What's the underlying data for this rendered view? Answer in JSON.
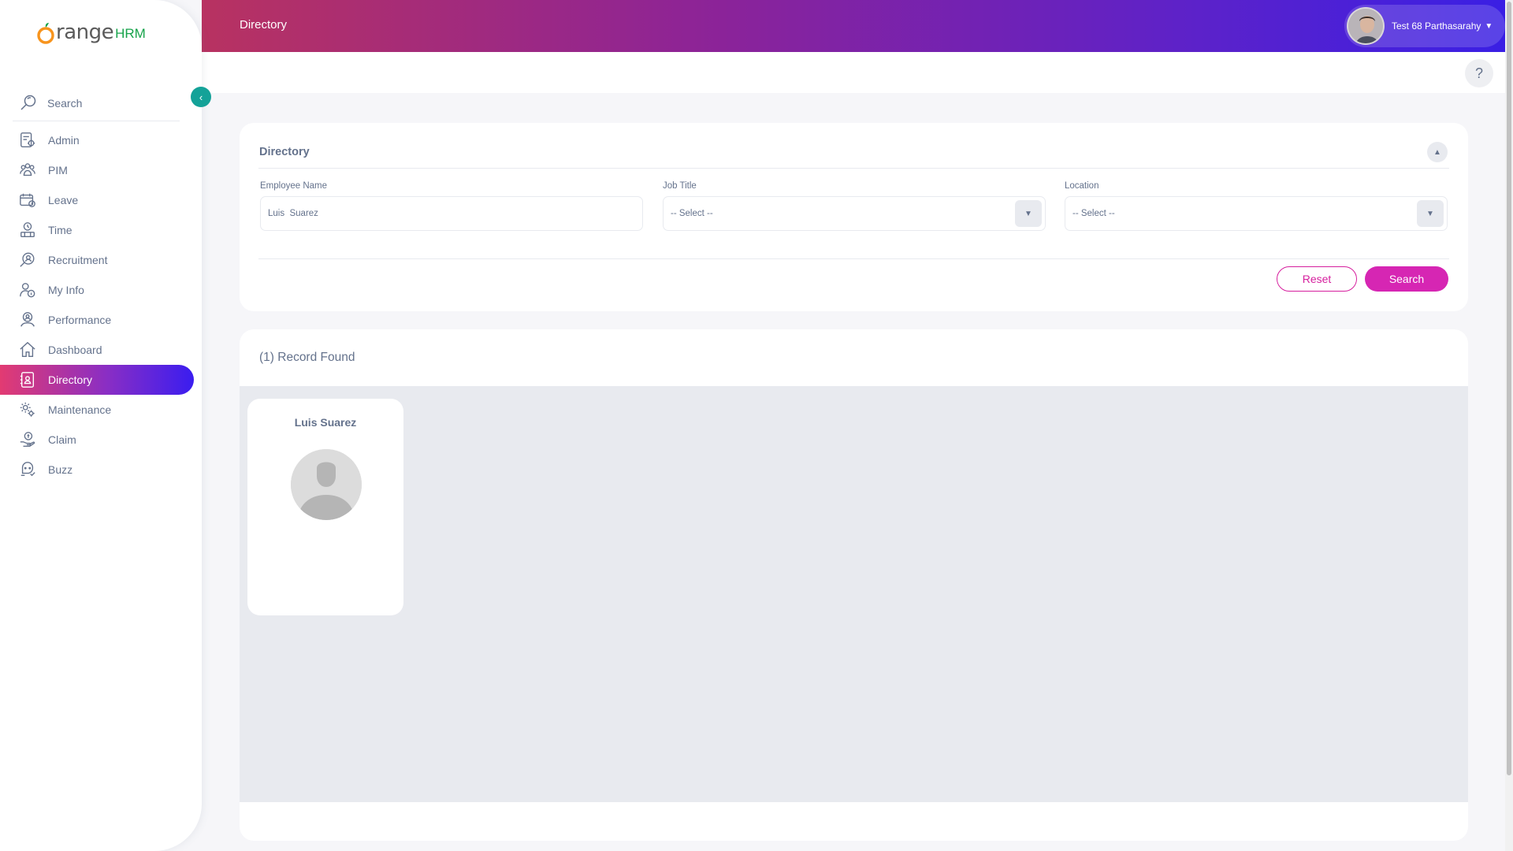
{
  "app": {
    "brand_text": "range",
    "brand_suffix": "HRM"
  },
  "topbar": {
    "title": "Directory",
    "user_name": "Test 68 Parthasarahy"
  },
  "sidebar": {
    "search_placeholder": "Search",
    "items": [
      {
        "label": "Admin",
        "icon": "admin-icon"
      },
      {
        "label": "PIM",
        "icon": "pim-icon"
      },
      {
        "label": "Leave",
        "icon": "leave-icon"
      },
      {
        "label": "Time",
        "icon": "time-icon"
      },
      {
        "label": "Recruitment",
        "icon": "recruitment-icon"
      },
      {
        "label": "My Info",
        "icon": "my-info-icon"
      },
      {
        "label": "Performance",
        "icon": "performance-icon"
      },
      {
        "label": "Dashboard",
        "icon": "dashboard-icon"
      },
      {
        "label": "Directory",
        "icon": "directory-icon",
        "active": true
      },
      {
        "label": "Maintenance",
        "icon": "maintenance-icon"
      },
      {
        "label": "Claim",
        "icon": "claim-icon"
      },
      {
        "label": "Buzz",
        "icon": "buzz-icon"
      }
    ]
  },
  "help": {
    "label": "?"
  },
  "filter": {
    "title": "Directory",
    "employee_name_label": "Employee Name",
    "employee_name_value": "Luis  Suarez",
    "job_title_label": "Job Title",
    "job_title_value": "-- Select --",
    "location_label": "Location",
    "location_value": "-- Select --",
    "reset_label": "Reset",
    "search_label": "Search"
  },
  "results": {
    "record_count": "(1) Record Found",
    "employees": [
      {
        "name": "Luis Suarez"
      }
    ]
  },
  "colors": {
    "accent": "#d626b3",
    "teal": "#14a298",
    "text": "#64728c"
  }
}
